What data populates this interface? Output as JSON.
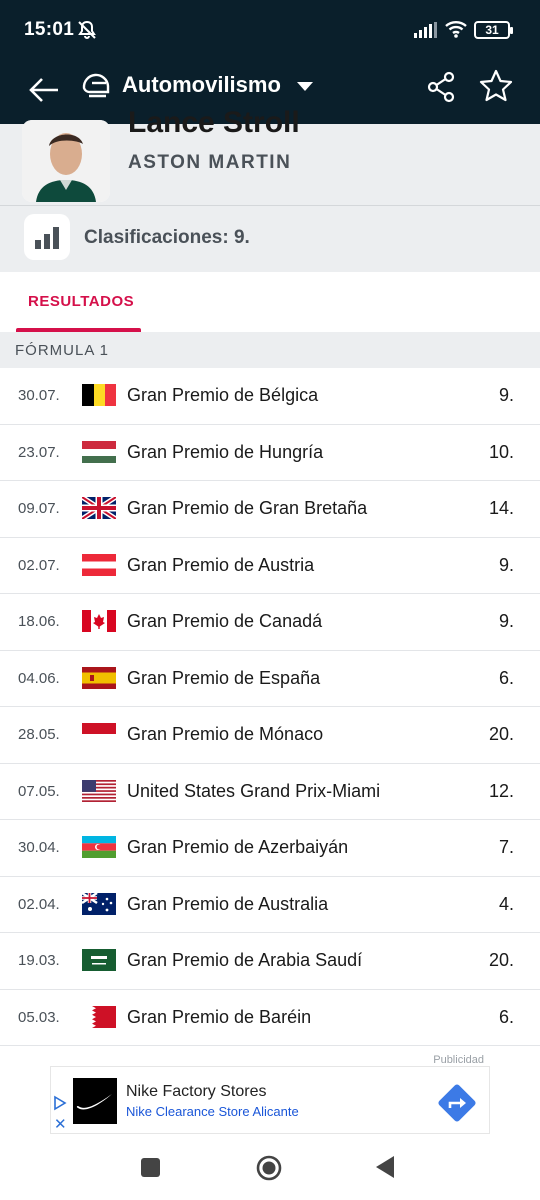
{
  "status_bar": {
    "time": "15:01",
    "battery": "31"
  },
  "app_bar": {
    "title": "Automovilismo"
  },
  "profile": {
    "name": "Lance Stroll",
    "team": "ASTON MARTIN"
  },
  "stats": {
    "ranking_text": "Clasificaciones: 9."
  },
  "tabs": [
    {
      "label": "RESULTADOS",
      "active": true
    }
  ],
  "section": {
    "label": "FÓRMULA 1"
  },
  "results": [
    {
      "date": "30.07.",
      "flag": "belgium",
      "race": "Gran Premio de Bélgica",
      "pos": "9."
    },
    {
      "date": "23.07.",
      "flag": "hungary",
      "race": "Gran Premio de Hungría",
      "pos": "10."
    },
    {
      "date": "09.07.",
      "flag": "uk",
      "race": "Gran Premio de Gran Bretaña",
      "pos": "14."
    },
    {
      "date": "02.07.",
      "flag": "austria",
      "race": "Gran Premio de Austria",
      "pos": "9."
    },
    {
      "date": "18.06.",
      "flag": "canada",
      "race": "Gran Premio de Canadá",
      "pos": "9."
    },
    {
      "date": "04.06.",
      "flag": "spain",
      "race": "Gran Premio de España",
      "pos": "6."
    },
    {
      "date": "28.05.",
      "flag": "monaco",
      "race": "Gran Premio de Mónaco",
      "pos": "20."
    },
    {
      "date": "07.05.",
      "flag": "usa",
      "race": "United States Grand Prix-Miami",
      "pos": "12."
    },
    {
      "date": "30.04.",
      "flag": "azerbaijan",
      "race": "Gran Premio de Azerbaiyán",
      "pos": "7."
    },
    {
      "date": "02.04.",
      "flag": "australia",
      "race": "Gran Premio de Australia",
      "pos": "4."
    },
    {
      "date": "19.03.",
      "flag": "saudi-arabia",
      "race": "Gran Premio de Arabia Saudí",
      "pos": "20."
    },
    {
      "date": "05.03.",
      "flag": "bahrain",
      "race": "Gran Premio de Baréin",
      "pos": "6."
    }
  ],
  "ad": {
    "label": "Publicidad",
    "title": "Nike Factory Stores",
    "subtitle": "Nike Clearance Store Alicante"
  },
  "colors": {
    "header_bg": "#0a1f2b",
    "accent": "#d5104a",
    "panel_bg": "#eceef0"
  }
}
